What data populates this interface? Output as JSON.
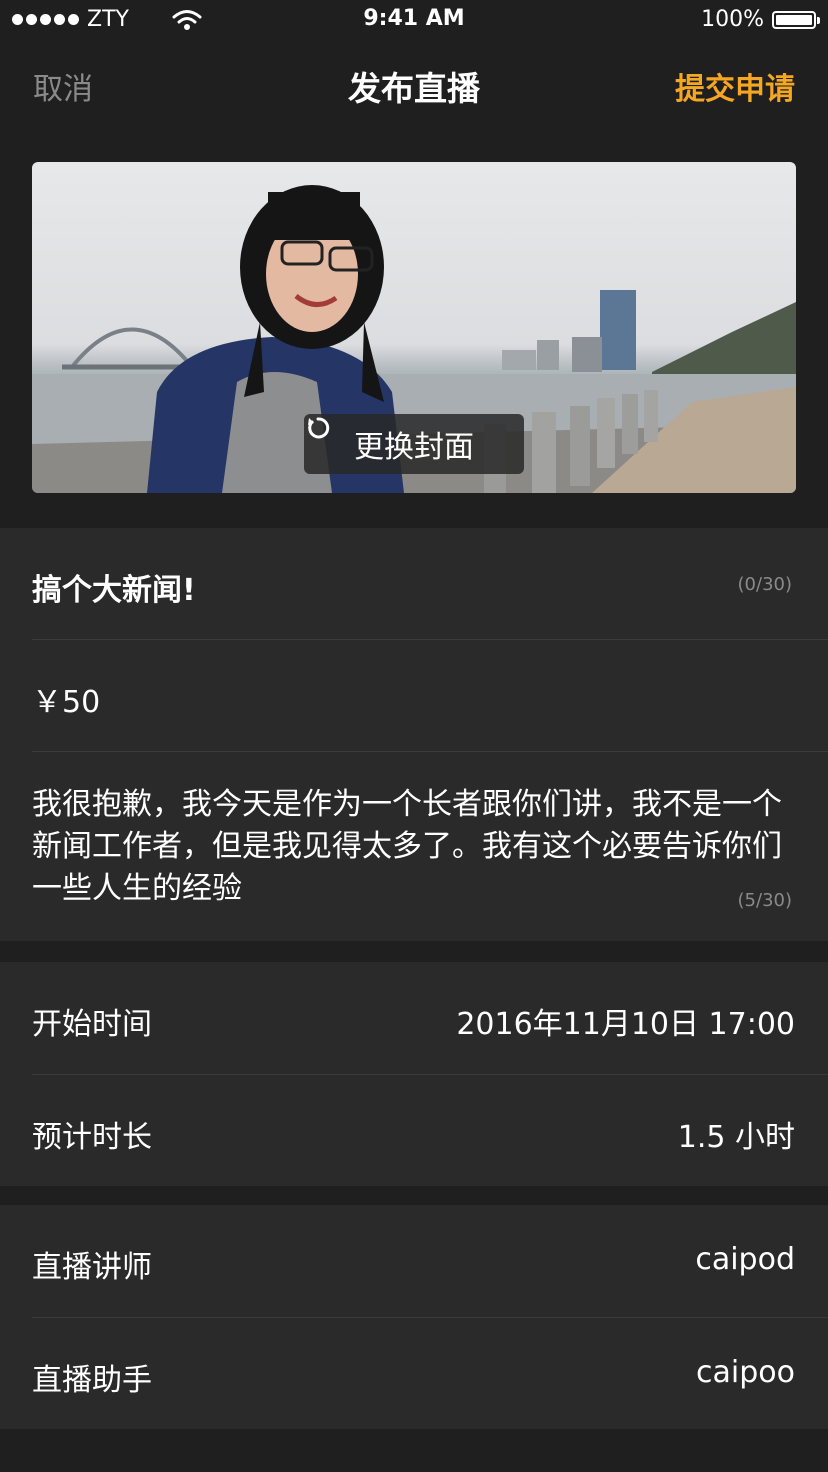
{
  "status_bar": {
    "carrier": "ZTY",
    "time": "9:41 AM",
    "battery": "100%",
    "battery_level": 1.0
  },
  "nav": {
    "cancel": "取消",
    "title": "发布直播",
    "submit": "提交申请",
    "accent": "#f5a623"
  },
  "cover": {
    "change_label": "更换封面",
    "icon": "refresh-icon"
  },
  "form": {
    "title_value": "搞个大新闻!",
    "title_counter": "(0/30)",
    "price": "￥50",
    "description": "我很抱歉，我今天是作为一个长者跟你们讲，我不是一个新闻工作者，但是我见得太多了。我有这个必要告诉你们一些人生的经验",
    "description_counter": "(5/30)"
  },
  "schedule": {
    "start_label": "开始时间",
    "start_value": "2016年11月10日 17:00",
    "duration_label": "预计时长",
    "duration_value": "1.5 小时"
  },
  "people": {
    "lecturer_label": "直播讲师",
    "lecturer_value": "caipod",
    "assistant_label": "直播助手",
    "assistant_value": "caipoo"
  }
}
